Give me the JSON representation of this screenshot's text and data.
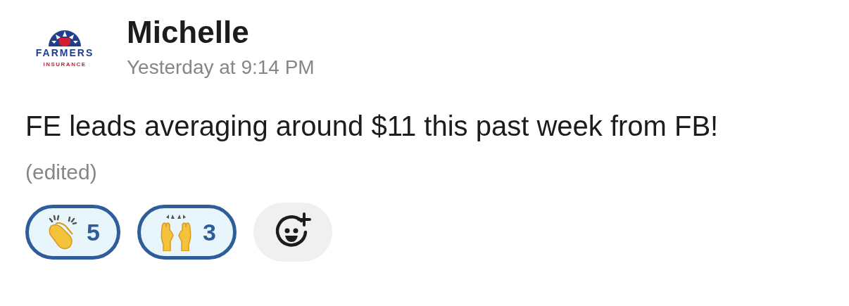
{
  "avatar": {
    "brand": "FARMERS",
    "subtitle": "INSURANCE"
  },
  "author": "Michelle",
  "timestamp": "Yesterday at 9:14 PM",
  "message": {
    "text": "FE leads averaging around $11 this past week from FB!",
    "edited_label": "(edited)"
  },
  "reactions": [
    {
      "kind": "clap",
      "count": "5",
      "selected": true
    },
    {
      "kind": "raised-hands",
      "count": "3",
      "selected": true
    }
  ]
}
